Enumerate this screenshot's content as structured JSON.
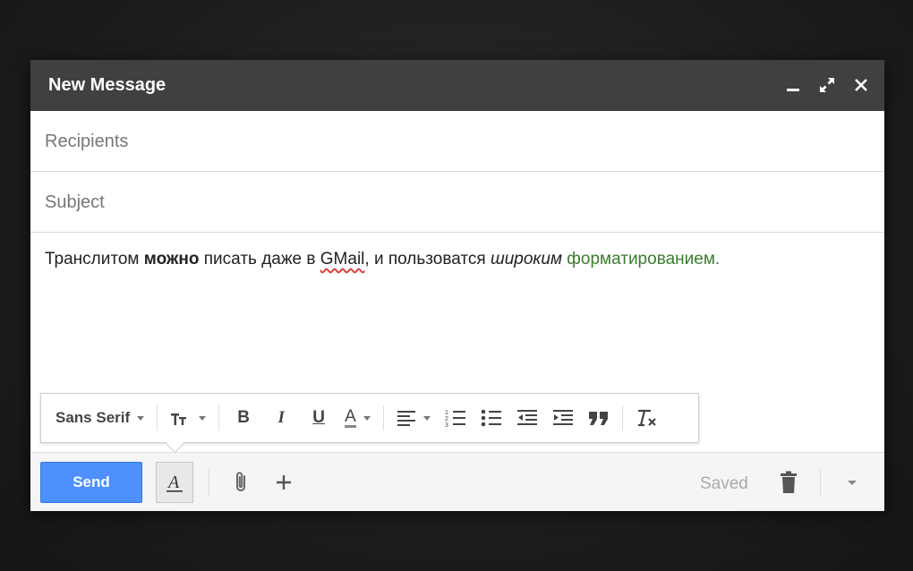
{
  "window": {
    "title": "New Message"
  },
  "fields": {
    "recipients_placeholder": "Recipients",
    "subject_placeholder": "Subject"
  },
  "body": {
    "seg1": "Транслитом ",
    "seg2_bold": "можно",
    "seg3": " писать даже в ",
    "seg4_misspelled": "GMail",
    "seg5": ", и пользоватся ",
    "seg6_italic": "широким",
    "seg7": " ",
    "seg8_green": "форматированием.",
    "green_color": "#3a7d2c"
  },
  "format_toolbar": {
    "font": "Sans Serif",
    "bold": "B",
    "italic": "I",
    "underline": "U",
    "text_color": "A"
  },
  "footer": {
    "send_label": "Send",
    "status": "Saved"
  },
  "colors": {
    "send": "#4d90fe",
    "titlebar": "#404040"
  }
}
